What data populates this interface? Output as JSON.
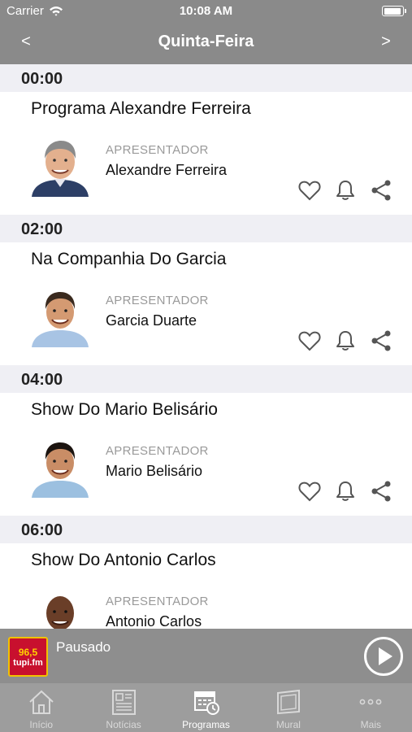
{
  "status_bar": {
    "carrier": "Carrier",
    "time": "10:08 AM"
  },
  "nav": {
    "title": "Quinta-Feira",
    "prev": "<",
    "next": ">"
  },
  "schedule": [
    {
      "time": "00:00",
      "title": "Programa Alexandre Ferreira",
      "role": "APRESENTADOR",
      "host": "Alexandre Ferreira"
    },
    {
      "time": "02:00",
      "title": "Na Companhia Do Garcia",
      "role": "APRESENTADOR",
      "host": "Garcia Duarte"
    },
    {
      "time": "04:00",
      "title": "Show Do Mario Belisário",
      "role": "APRESENTADOR",
      "host": "Mario Belisário"
    },
    {
      "time": "06:00",
      "title": "Show Do Antonio Carlos",
      "role": "APRESENTADOR",
      "host": "Antonio Carlos"
    }
  ],
  "player": {
    "status": "Pausado",
    "logo_number": "96,5",
    "logo_name": "tupi.fm"
  },
  "tabs": [
    {
      "label": "Início",
      "icon": "home-icon",
      "active": false
    },
    {
      "label": "Notícias",
      "icon": "newspaper-icon",
      "active": false
    },
    {
      "label": "Programas",
      "icon": "calendar-clock-icon",
      "active": true
    },
    {
      "label": "Mural",
      "icon": "board-icon",
      "active": false
    },
    {
      "label": "Mais",
      "icon": "more-icon",
      "active": false
    }
  ],
  "colors": {
    "bar_gray": "#8a8a8a",
    "section_bg": "#efeff4",
    "tab_active": "#ffffff",
    "tab_inactive": "#d9d9d9"
  }
}
